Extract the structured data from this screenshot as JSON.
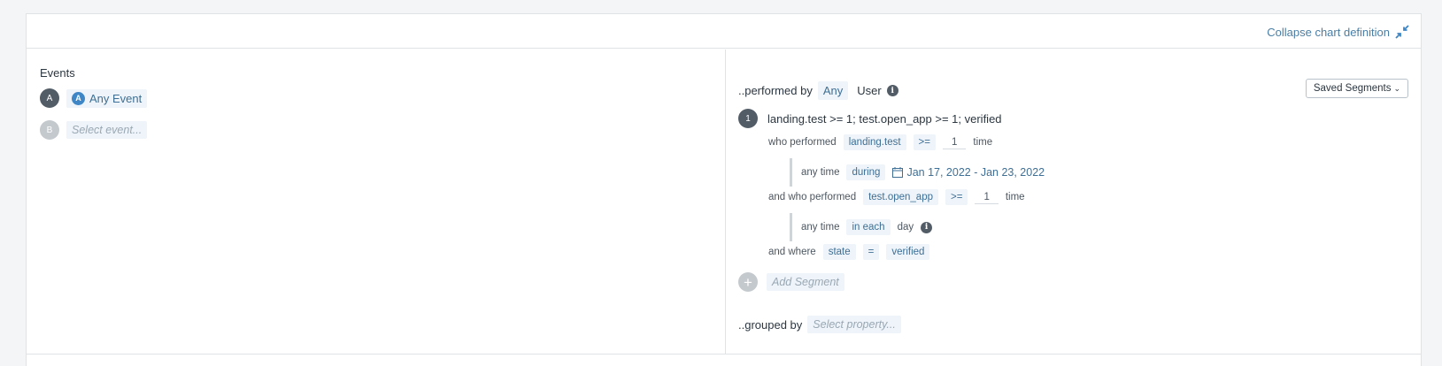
{
  "header": {
    "collapse_label": "Collapse chart definition",
    "collapse_icon": "collapse-arrows-icon"
  },
  "events": {
    "title": "Events",
    "items": [
      {
        "letter": "A",
        "label": "Any Event",
        "icon": "any-event-icon"
      },
      {
        "letter": "B",
        "placeholder": "Select event..."
      }
    ]
  },
  "segments": {
    "performed_by_label": "..performed by",
    "any_label": "Any",
    "user_label": "User",
    "saved_segments_label": "Saved Segments",
    "segment": {
      "number": "1",
      "summary": "landing.test >= 1; test.open_app >= 1; verified",
      "clause1": {
        "prefix": "who performed",
        "event": "landing.test",
        "operator": ">=",
        "count": "1",
        "suffix": "time",
        "sub": {
          "prefix": "any time",
          "mode": "during",
          "date_range": "Jan 17, 2022 - Jan 23, 2022"
        }
      },
      "clause2": {
        "prefix": "and who performed",
        "event": "test.open_app",
        "operator": ">=",
        "count": "1",
        "suffix": "time",
        "sub": {
          "prefix": "any time",
          "mode": "in each",
          "unit": "day"
        }
      },
      "clause3": {
        "prefix": "and where",
        "property": "state",
        "operator": "=",
        "value": "verified"
      }
    },
    "add_segment_label": "Add Segment",
    "grouped_by_label": "..grouped by",
    "grouped_by_placeholder": "Select property..."
  },
  "colors": {
    "accent_text": "#3f6f95",
    "chip_bg": "#eef4f9",
    "event_icon": "#3e86c6",
    "badge_dark": "#525c66",
    "badge_light": "#c4c9ce"
  }
}
